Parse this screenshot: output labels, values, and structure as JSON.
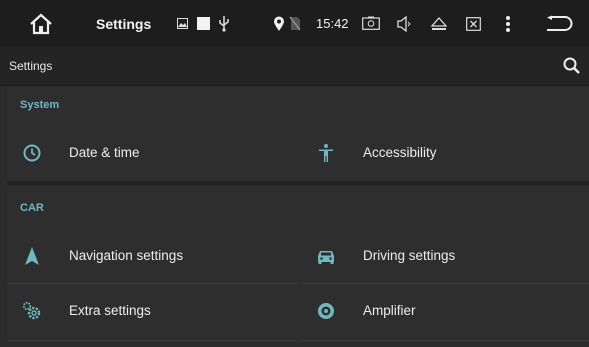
{
  "statusbar": {
    "home_icon": "home-icon",
    "title": "Settings",
    "time": "15:42",
    "icons": [
      "picture-icon",
      "square-icon",
      "usb-icon",
      "location-icon",
      "no-sim-icon",
      "screenshot-icon",
      "volume-icon",
      "eject-icon",
      "close-box-icon",
      "more-vert-icon",
      "back-icon"
    ]
  },
  "appbar": {
    "title": "Settings",
    "search_icon": "search-icon"
  },
  "sections": [
    {
      "header": "System",
      "items": [
        {
          "label": "Date & time",
          "icon": "clock-icon"
        },
        {
          "label": "Accessibility",
          "icon": "accessibility-icon"
        }
      ]
    },
    {
      "header": "CAR",
      "items": [
        {
          "label": "Navigation settings",
          "icon": "navigation-arrow-icon"
        },
        {
          "label": "Driving settings",
          "icon": "car-icon"
        },
        {
          "label": "Extra settings",
          "icon": "gears-icon"
        },
        {
          "label": "Amplifier",
          "icon": "speaker-icon"
        }
      ]
    }
  ],
  "colors": {
    "accent": "#6fb8c2",
    "background": "#2c2c2c",
    "statusbar": "#1d1d1d"
  }
}
